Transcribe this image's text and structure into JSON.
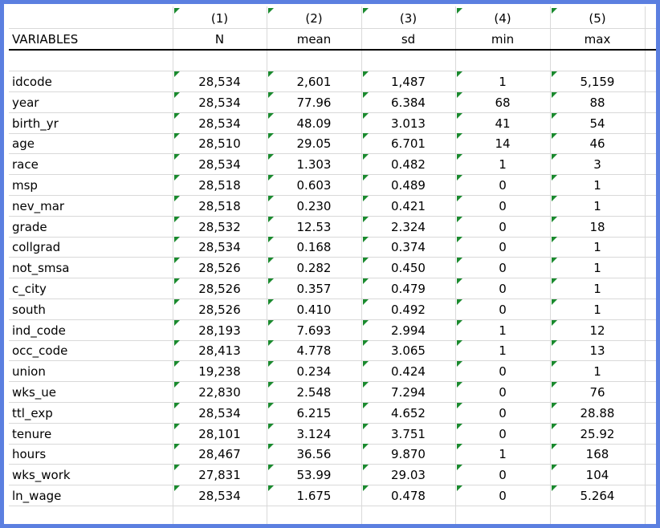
{
  "table": {
    "column_numbers": [
      "(1)",
      "(2)",
      "(3)",
      "(4)",
      "(5)"
    ],
    "headers": {
      "variables": "VARIABLES",
      "columns": [
        "N",
        "mean",
        "sd",
        "min",
        "max"
      ]
    },
    "rows": [
      {
        "name": "idcode",
        "values": [
          "28,534",
          "2,601",
          "1,487",
          "1",
          "5,159"
        ]
      },
      {
        "name": "year",
        "values": [
          "28,534",
          "77.96",
          "6.384",
          "68",
          "88"
        ]
      },
      {
        "name": "birth_yr",
        "values": [
          "28,534",
          "48.09",
          "3.013",
          "41",
          "54"
        ]
      },
      {
        "name": "age",
        "values": [
          "28,510",
          "29.05",
          "6.701",
          "14",
          "46"
        ]
      },
      {
        "name": "race",
        "values": [
          "28,534",
          "1.303",
          "0.482",
          "1",
          "3"
        ]
      },
      {
        "name": "msp",
        "values": [
          "28,518",
          "0.603",
          "0.489",
          "0",
          "1"
        ]
      },
      {
        "name": "nev_mar",
        "values": [
          "28,518",
          "0.230",
          "0.421",
          "0",
          "1"
        ]
      },
      {
        "name": "grade",
        "values": [
          "28,532",
          "12.53",
          "2.324",
          "0",
          "18"
        ]
      },
      {
        "name": "collgrad",
        "values": [
          "28,534",
          "0.168",
          "0.374",
          "0",
          "1"
        ]
      },
      {
        "name": "not_smsa",
        "values": [
          "28,526",
          "0.282",
          "0.450",
          "0",
          "1"
        ]
      },
      {
        "name": "c_city",
        "values": [
          "28,526",
          "0.357",
          "0.479",
          "0",
          "1"
        ]
      },
      {
        "name": "south",
        "values": [
          "28,526",
          "0.410",
          "0.492",
          "0",
          "1"
        ]
      },
      {
        "name": "ind_code",
        "values": [
          "28,193",
          "7.693",
          "2.994",
          "1",
          "12"
        ]
      },
      {
        "name": "occ_code",
        "values": [
          "28,413",
          "4.778",
          "3.065",
          "1",
          "13"
        ]
      },
      {
        "name": "union",
        "values": [
          "19,238",
          "0.234",
          "0.424",
          "0",
          "1"
        ]
      },
      {
        "name": "wks_ue",
        "values": [
          "22,830",
          "2.548",
          "7.294",
          "0",
          "76"
        ]
      },
      {
        "name": "ttl_exp",
        "values": [
          "28,534",
          "6.215",
          "4.652",
          "0",
          "28.88"
        ]
      },
      {
        "name": "tenure",
        "values": [
          "28,101",
          "3.124",
          "3.751",
          "0",
          "25.92"
        ]
      },
      {
        "name": "hours",
        "values": [
          "28,467",
          "36.56",
          "9.870",
          "1",
          "168"
        ]
      },
      {
        "name": "wks_work",
        "values": [
          "27,831",
          "53.99",
          "29.03",
          "0",
          "104"
        ]
      },
      {
        "name": "ln_wage",
        "values": [
          "28,534",
          "1.675",
          "0.478",
          "0",
          "5.264"
        ]
      }
    ]
  },
  "colors": {
    "frame_border": "#5b7fe0",
    "gridline": "#d9d9d9",
    "error_indicator": "#1a8a2e"
  }
}
